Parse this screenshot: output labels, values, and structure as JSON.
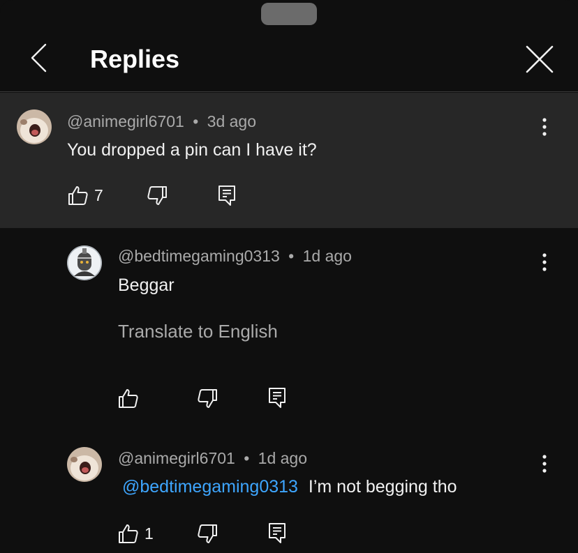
{
  "header": {
    "title": "Replies"
  },
  "parent_comment": {
    "author": "@animegirl6701",
    "separator": "•",
    "time": "3d ago",
    "text": "You dropped a pin can I have it?",
    "likes": "7"
  },
  "replies": [
    {
      "author": "@bedtimegaming0313",
      "separator": "•",
      "time": "1d ago",
      "text": "Beggar",
      "translate": "Translate to English",
      "likes": ""
    },
    {
      "author": "@animegirl6701",
      "separator": "•",
      "time": "1d ago",
      "mention": "@bedtimegaming0313",
      "text": "I’m not begging tho",
      "likes": "1"
    }
  ],
  "colors": {
    "background": "#0f0f0f",
    "highlight": "#272727",
    "mention": "#3ea6ff",
    "meta": "#aaaaaa"
  },
  "icons": [
    "chevron-left-icon",
    "close-icon",
    "kebab-menu-icon",
    "thumb-up-icon",
    "thumb-down-icon",
    "reply-icon"
  ]
}
